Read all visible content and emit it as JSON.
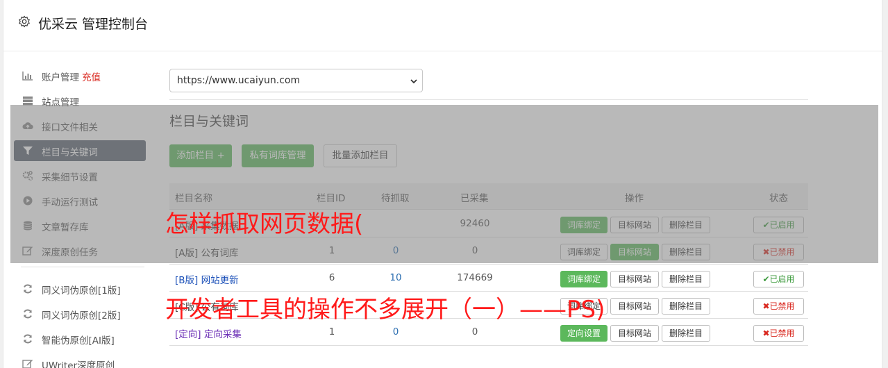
{
  "app": {
    "title": "优采云 管理控制台"
  },
  "sidebar": {
    "items": [
      {
        "label": "账户管理",
        "extra": "充值",
        "icon": "bar-chart-icon"
      },
      {
        "label": "站点管理",
        "icon": "server-icon"
      },
      {
        "label": "接口文件相关",
        "icon": "cloud-upload-icon"
      },
      {
        "label": "栏目与关键词",
        "icon": "filter-icon",
        "active": true
      },
      {
        "label": "采集细节设置",
        "icon": "cogs-icon"
      },
      {
        "label": "手动运行测试",
        "icon": "play-circle-icon"
      },
      {
        "label": "文章暂存库",
        "icon": "database-icon"
      },
      {
        "label": "深度原创任务",
        "icon": "edit-icon"
      }
    ],
    "items2": [
      {
        "label": "同义词伪原创[1版]",
        "icon": "refresh-icon"
      },
      {
        "label": "同义词伪原创[2版]",
        "icon": "refresh-icon"
      },
      {
        "label": "智能伪原创[AI版]",
        "icon": "refresh-icon"
      },
      {
        "label": "UWriter深度原创",
        "icon": "edit-icon"
      }
    ]
  },
  "site_select": {
    "value": "https://www.ucaiyun.com"
  },
  "section": {
    "title": "栏目与关键词"
  },
  "toolbar": {
    "add_column": "添加栏目 +",
    "private_lexicon": "私有词库管理",
    "batch_add": "批量添加栏目"
  },
  "table": {
    "headers": {
      "name": "栏目名称",
      "id": "栏目ID",
      "pending": "待抓取",
      "collected": "已采集",
      "ops": "操作",
      "status": "状态"
    },
    "rows": [
      {
        "name": "[A版] 采集数据",
        "id": "",
        "pending": "",
        "collected": "92460",
        "btn1": "词库绑定",
        "btn2": "目标网站",
        "btn3": "删除栏目",
        "status": "✔已启用"
      },
      {
        "name": "[A版] 公有词库",
        "id": "1",
        "pending": "0",
        "collected": "0",
        "btn1": "词库绑定",
        "btn2": "目标网站",
        "btn3": "删除栏目",
        "status": "✖已禁用"
      },
      {
        "name": "[B版] 网站更新",
        "id": "6",
        "pending": "10",
        "collected": "174669",
        "btn1": "词库绑定",
        "btn2": "目标网站",
        "btn3": "删除栏目",
        "status": "✔已启用"
      },
      {
        "name": "[C版] 公有词库",
        "id": "",
        "pending": "",
        "collected": "",
        "btn1": "词库绑定",
        "btn2": "目标网站",
        "btn3": "删除栏目",
        "status": "✖已禁用"
      },
      {
        "name": "[定向] 定向采集",
        "id": "1",
        "pending": "0",
        "collected": "0",
        "btn1": "定向设置",
        "btn2": "目标网站",
        "btn3": "删除栏目",
        "status": "✖已禁用"
      }
    ]
  },
  "watermark": {
    "line1": "怎样抓取网页数据(",
    "line2": "开发者工具的操作不多展开（一）——PS)"
  },
  "colors": {
    "green": "#5cb85c",
    "active_nav": "#5a6270",
    "red": "#d9281f",
    "watermark": "#ff1a1a"
  }
}
